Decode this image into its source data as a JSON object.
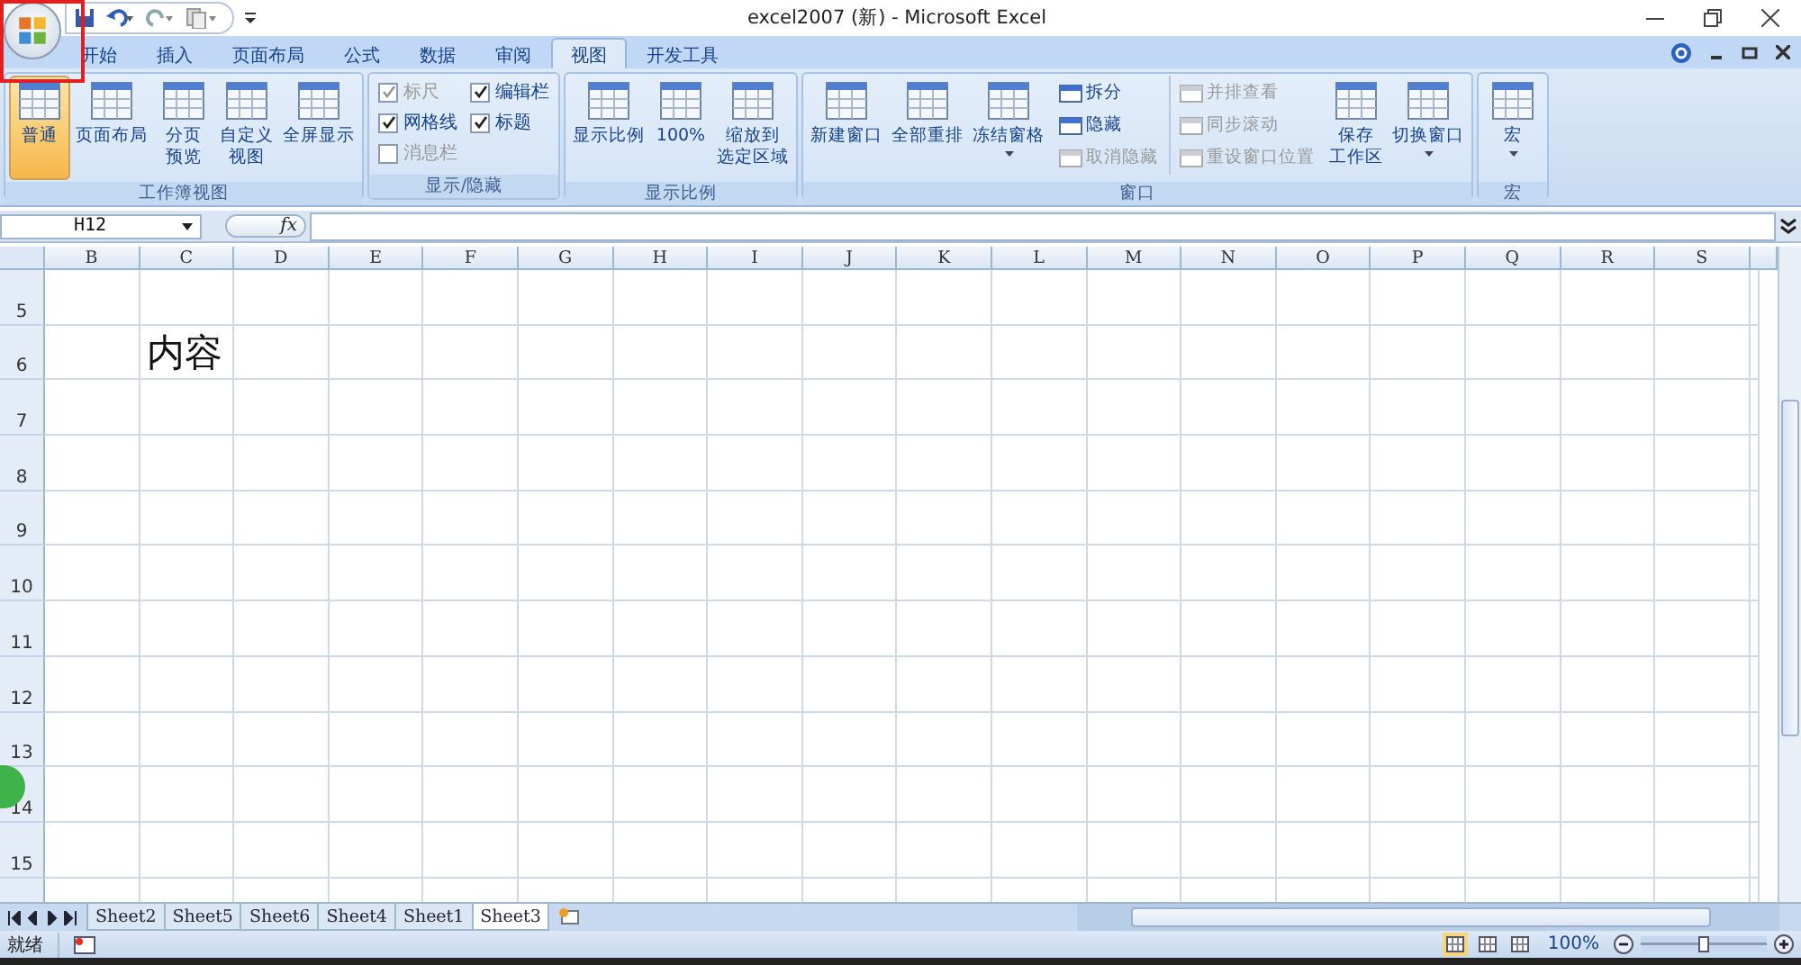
{
  "window": {
    "title": "excel2007 (新) - Microsoft Excel"
  },
  "tabs": [
    {
      "label": "开始",
      "selected": false
    },
    {
      "label": "插入",
      "selected": false
    },
    {
      "label": "页面布局",
      "selected": false
    },
    {
      "label": "公式",
      "selected": false
    },
    {
      "label": "数据",
      "selected": false
    },
    {
      "label": "审阅",
      "selected": false
    },
    {
      "label": "视图",
      "selected": true
    },
    {
      "label": "开发工具",
      "selected": false
    }
  ],
  "ribbon_groups": [
    {
      "title": "工作簿视图",
      "columns": [
        {
          "kind": "large",
          "items": [
            {
              "lines": [
                "普通"
              ],
              "selected": true,
              "disabled": false,
              "dropdown": false
            }
          ]
        },
        {
          "kind": "large",
          "items": [
            {
              "lines": [
                "页面布局"
              ],
              "selected": false,
              "disabled": false,
              "dropdown": false
            }
          ]
        },
        {
          "kind": "large",
          "items": [
            {
              "lines": [
                "分页",
                "预览"
              ],
              "selected": false,
              "disabled": false,
              "dropdown": false
            }
          ]
        },
        {
          "kind": "large",
          "items": [
            {
              "lines": [
                "自定义",
                "视图"
              ],
              "selected": false,
              "disabled": false,
              "dropdown": false
            }
          ]
        },
        {
          "kind": "large",
          "items": [
            {
              "lines": [
                "全屏显示"
              ],
              "selected": false,
              "disabled": false,
              "dropdown": false
            }
          ]
        }
      ]
    },
    {
      "title": "显示/隐藏",
      "columns": [
        {
          "kind": "check",
          "items": [
            {
              "label": "标尺",
              "checked": true,
              "disabled": true
            },
            {
              "label": "网格线",
              "checked": true,
              "disabled": false
            },
            {
              "label": "消息栏",
              "checked": false,
              "disabled": true
            }
          ]
        },
        {
          "kind": "check",
          "items": [
            {
              "label": "编辑栏",
              "checked": true,
              "disabled": false
            },
            {
              "label": "标题",
              "checked": true,
              "disabled": false
            }
          ]
        }
      ]
    },
    {
      "title": "显示比例",
      "columns": [
        {
          "kind": "large",
          "items": [
            {
              "lines": [
                "显示比例"
              ],
              "selected": false,
              "disabled": false,
              "dropdown": false
            }
          ]
        },
        {
          "kind": "large",
          "items": [
            {
              "lines": [
                "100%"
              ],
              "selected": false,
              "disabled": false,
              "dropdown": false
            }
          ]
        },
        {
          "kind": "large",
          "items": [
            {
              "lines": [
                "缩放到",
                "选定区域"
              ],
              "selected": false,
              "disabled": false,
              "dropdown": false
            }
          ]
        }
      ]
    },
    {
      "title": "窗口",
      "columns": [
        {
          "kind": "large",
          "items": [
            {
              "lines": [
                "新建窗口"
              ],
              "selected": false,
              "disabled": false,
              "dropdown": false
            }
          ]
        },
        {
          "kind": "large",
          "items": [
            {
              "lines": [
                "全部重排"
              ],
              "selected": false,
              "disabled": false,
              "dropdown": false
            }
          ]
        },
        {
          "kind": "large",
          "items": [
            {
              "lines": [
                "冻结窗格"
              ],
              "selected": false,
              "disabled": false,
              "dropdown": true
            }
          ]
        },
        {
          "kind": "small",
          "items": [
            {
              "label": "拆分",
              "disabled": false
            },
            {
              "label": "隐藏",
              "disabled": false
            },
            {
              "label": "取消隐藏",
              "disabled": true
            }
          ]
        },
        {
          "kind": "small",
          "items": [
            {
              "label": "并排查看",
              "disabled": true
            },
            {
              "label": "同步滚动",
              "disabled": true
            },
            {
              "label": "重设窗口位置",
              "disabled": true
            }
          ]
        },
        {
          "kind": "large",
          "items": [
            {
              "lines": [
                "保存",
                "工作区"
              ],
              "selected": false,
              "disabled": false,
              "dropdown": false
            }
          ]
        },
        {
          "kind": "large",
          "items": [
            {
              "lines": [
                "切换窗口"
              ],
              "selected": false,
              "disabled": false,
              "dropdown": true
            }
          ]
        }
      ]
    },
    {
      "title": "宏",
      "columns": [
        {
          "kind": "large",
          "items": [
            {
              "lines": [
                "宏"
              ],
              "selected": false,
              "disabled": false,
              "dropdown": true
            }
          ]
        }
      ]
    }
  ],
  "formula_bar": {
    "name_box": "H12",
    "fx": "fx"
  },
  "sheet": {
    "columns": [
      "B",
      "C",
      "D",
      "E",
      "F",
      "G",
      "H",
      "I",
      "J",
      "K",
      "L",
      "M",
      "N",
      "O",
      "P",
      "Q",
      "R",
      "S"
    ],
    "rows": [
      {
        "number": "5",
        "cells": []
      },
      {
        "number": "6",
        "cells": [
          "",
          "内容"
        ]
      },
      {
        "number": "7",
        "cells": []
      },
      {
        "number": "8",
        "cells": []
      },
      {
        "number": "9",
        "cells": []
      },
      {
        "number": "10",
        "cells": []
      },
      {
        "number": "11",
        "cells": []
      },
      {
        "number": "12",
        "cells": []
      },
      {
        "number": "13",
        "cells": []
      },
      {
        "number": "14",
        "cells": []
      },
      {
        "number": "15",
        "cells": []
      }
    ]
  },
  "sheet_tabs": [
    {
      "label": "Sheet2",
      "selected": false
    },
    {
      "label": "Sheet5",
      "selected": false
    },
    {
      "label": "Sheet6",
      "selected": false
    },
    {
      "label": "Sheet4",
      "selected": false
    },
    {
      "label": "Sheet1",
      "selected": false
    },
    {
      "label": "Sheet3",
      "selected": true
    }
  ],
  "status_bar": {
    "status": "就绪",
    "views": [
      {
        "selected": true
      },
      {
        "selected": false
      },
      {
        "selected": false
      }
    ],
    "zoom": "100%",
    "zoom_slider": {
      "level": 0.5
    }
  }
}
